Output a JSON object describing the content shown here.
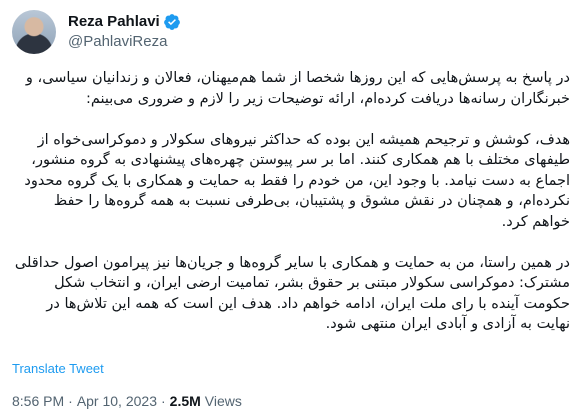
{
  "author": {
    "display_name": "Reza Pahlavi",
    "handle": "@PahlaviReza",
    "verified_color": "#1d9bf0"
  },
  "tweet": {
    "paragraphs": [
      "در پاسخ به پرسش‌هایی که این روزها شخصا از شما هم‌میهنان، فعالان و زندانیان سیاسی، و خبرنگاران رسانه‌ها دریافت کرده‌ام، ارائه توضیحات زیر را لازم و ضروری می‌بینم:",
      "هدف، کوشش و ترجیحم همیشه این بوده که حداکثر نیروهای سکولار و دموکراسی‌خواه از طیفهای مختلف با هم همکاری کنند. اما بر سر پیوستن چهره‌های پیشنهادی به گروه منشور، اجماع به دست نیامد. با وجود این، من خودم را فقط به حمایت و همکاری با یک گروه محدود نکرده‌ام، و همچنان در نقش مشوق و پشتیبان، بی‌طرفی نسبت به همه گروه‌ها را حفظ خواهم کرد.",
      "در همین راستا، من به حمایت و همکاری با سایر گروه‌ها و جریان‌ها نیز پیرامون اصول حداقلی مشترک: دموکراسی سکولار مبتنی بر حقوق بشر، تمامیت ارضی ایران، و انتخاب شکل حکومت آینده با رای ملت ایران، ادامه خواهم داد. هدف این است که همه این تلاش‌ها در نهایت به آزادی و آبادی ایران منتهی شود."
    ]
  },
  "translate_label": "Translate Tweet",
  "meta": {
    "time": "8:56 PM",
    "separator": "·",
    "date": "Apr 10, 2023",
    "views_count": "2.5M",
    "views_label": "Views"
  }
}
